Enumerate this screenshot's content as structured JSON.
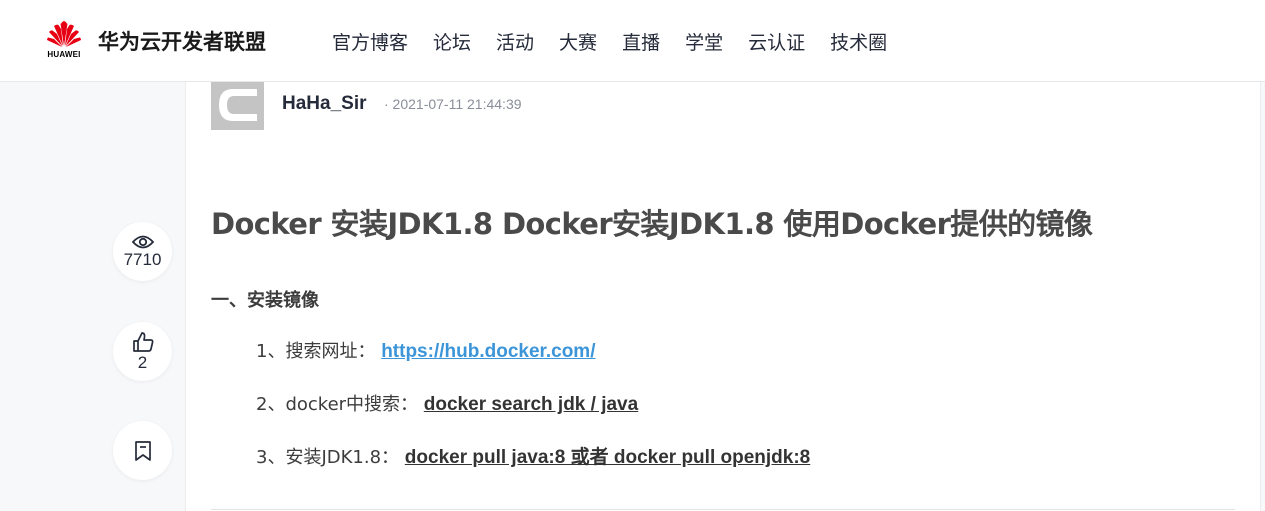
{
  "header": {
    "logo_text": "HUAWEI",
    "brand": "华为云开发者联盟",
    "nav": [
      "官方博客",
      "论坛",
      "活动",
      "大赛",
      "直播",
      "学堂",
      "云认证",
      "技术圈"
    ]
  },
  "colors": {
    "accent": "#e60012",
    "link": "#3b95d8",
    "muted": "#8a8e99"
  },
  "sidebar_actions": [
    {
      "icon": "eye-icon",
      "count": "7710"
    },
    {
      "icon": "thumbs-up-icon",
      "count": "2"
    },
    {
      "icon": "bookmark-icon",
      "count": ""
    }
  ],
  "article": {
    "author": "HaHa_Sir",
    "date": "· 2021-07-11 21:44:39",
    "title": "Docker 安装JDK1.8 Docker安装JDK1.8 使用Docker提供的镜像",
    "section_heading": "一、安装镜像",
    "steps": [
      {
        "label": "1、搜索网址：",
        "value": "https://hub.docker.com/"
      },
      {
        "label": "2、docker中搜索：",
        "value": "docker search jdk / java"
      },
      {
        "label": "3、安装JDK1.8：",
        "value": "docker pull java:8 或者 docker pull openjdk:8"
      }
    ]
  }
}
